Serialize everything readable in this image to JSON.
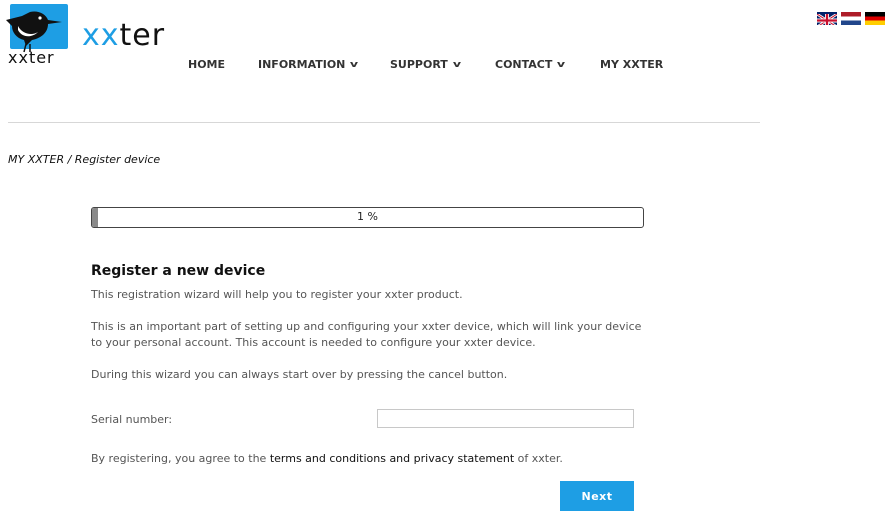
{
  "brand": {
    "logo_text": "xxter",
    "logo_small": "xxter",
    "accent_color": "#1e9ee4"
  },
  "languages": [
    {
      "name": "uk-flag-icon"
    },
    {
      "name": "nl-flag-icon"
    },
    {
      "name": "de-flag-icon"
    }
  ],
  "nav": {
    "home": "HOME",
    "information": "INFORMATION",
    "support": "SUPPORT",
    "contact": "CONTACT",
    "my_xxter": "MY XXTER"
  },
  "breadcrumb": "MY XXTER  /  Register device",
  "progress": {
    "value": 1,
    "label": "1 %"
  },
  "wizard": {
    "heading": "Register a new device",
    "intro": "This registration wizard will help you to register your xxter product.",
    "important": "This is an important part of setting up and configuring your xxter device, which will link your device to your personal account. This account is needed to configure your xxter device.",
    "cancel_note": "During this wizard you can always start over by pressing the cancel button.",
    "serial_label": "Serial number:",
    "serial_value": "",
    "terms_prefix": "By registering, you agree to the",
    "terms_link": "terms and conditions and privacy statement",
    "terms_suffix": "of xxter.",
    "next_label": "Next"
  }
}
